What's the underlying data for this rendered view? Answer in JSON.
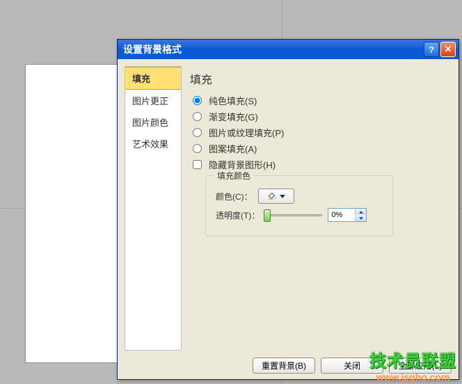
{
  "dialog": {
    "title": "设置背景格式"
  },
  "sidebar": {
    "items": [
      {
        "label": "填充"
      },
      {
        "label": "图片更正"
      },
      {
        "label": "图片颜色"
      },
      {
        "label": "艺术效果"
      }
    ]
  },
  "content": {
    "heading": "填充",
    "radios": [
      {
        "label": "纯色填充(S)"
      },
      {
        "label": "渐变填充(G)"
      },
      {
        "label": "图片或纹理填充(P)"
      },
      {
        "label": "图案填充(A)"
      }
    ],
    "checkbox": {
      "label": "隐藏背景图形(H)"
    },
    "fill_color_group": {
      "legend": "填充颜色",
      "color_label": "颜色(C)：",
      "transparency_label": "透明度(T)：",
      "transparency_value": "0%"
    }
  },
  "footer": {
    "reset": "重置背景(B)",
    "close": "关闭",
    "apply_all": "全部应用(L)"
  },
  "watermark": {
    "text": "技术员联盟",
    "url": "www.jsgho.com"
  }
}
